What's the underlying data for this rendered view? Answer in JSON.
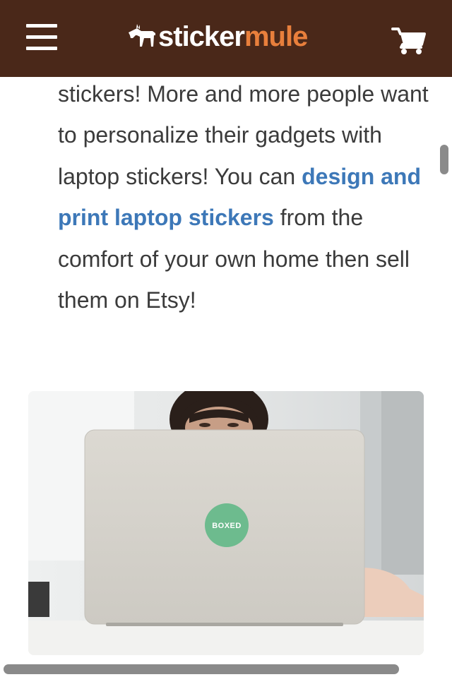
{
  "header": {
    "menu_icon": "hamburger-menu-icon",
    "logo": {
      "part1": "sticker",
      "part2": "mule",
      "mascot_icon": "mule-icon"
    },
    "cart_icon": "shopping-cart-icon",
    "background_color": "#4a2819",
    "accent_color": "#e87f3c"
  },
  "article": {
    "text_before_link": "stickers! More and more people want to personalize their gadgets with laptop stickers! You can ",
    "link_text": "design and print laptop stickers",
    "text_after_link": " from the comfort of your own home then sell them on Etsy!",
    "link_color": "#3d78b8"
  },
  "image": {
    "sticker_text": "BOXED",
    "sticker_color": "#6dbb8e"
  }
}
